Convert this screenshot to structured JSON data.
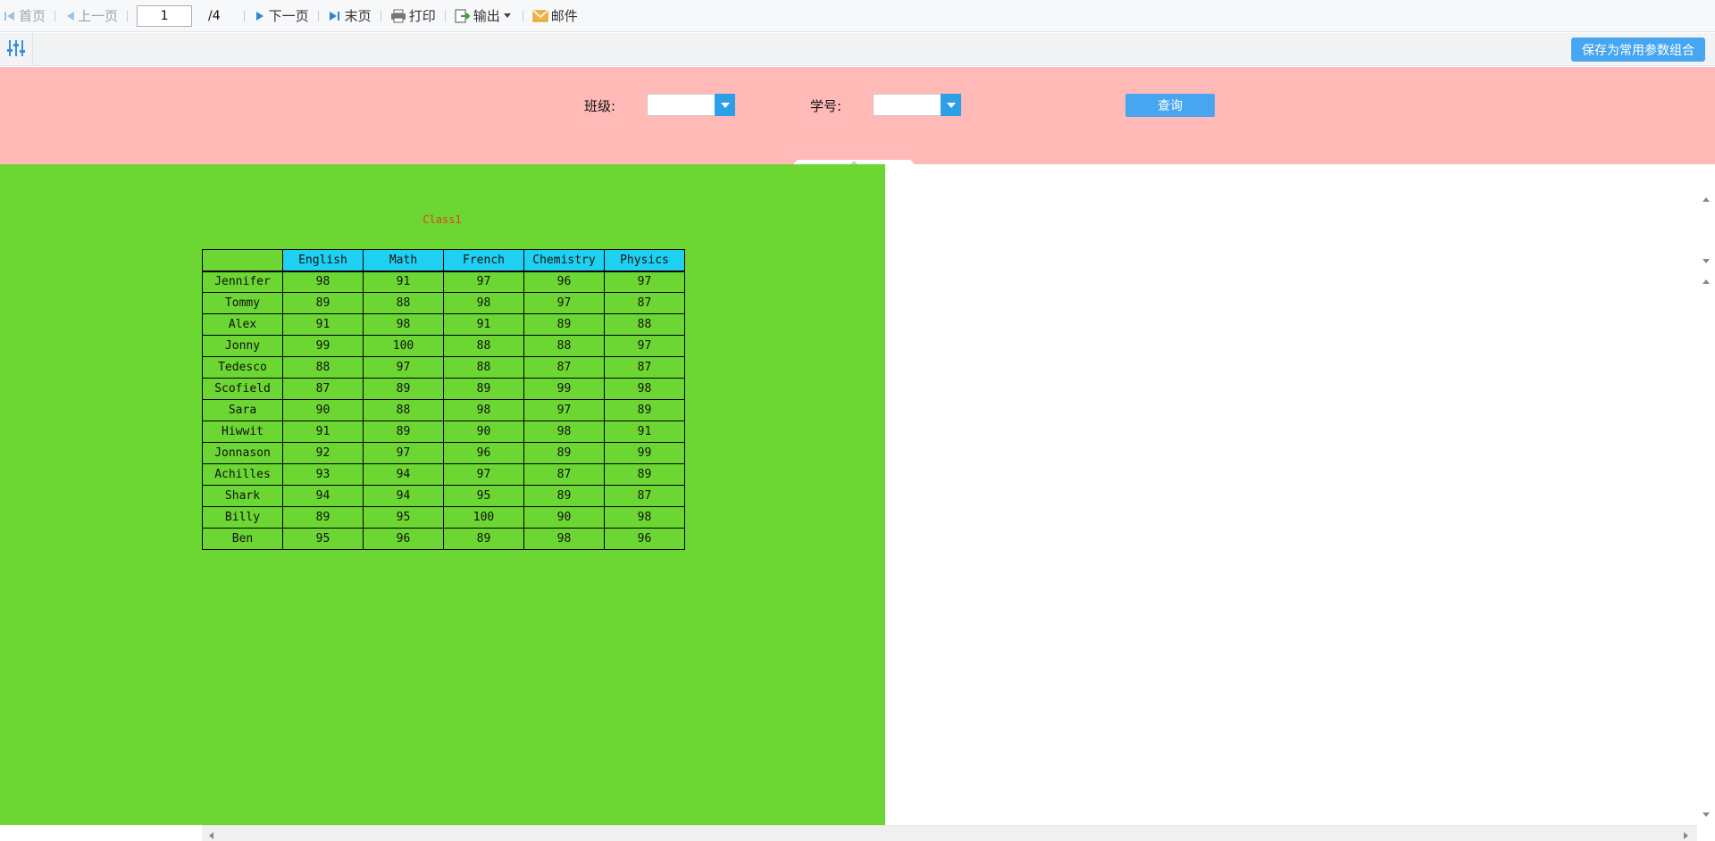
{
  "toolbar": {
    "first_label": "首页",
    "prev_label": "上一页",
    "page_current": "1",
    "page_total": "/4",
    "next_label": "下一页",
    "last_label": "末页",
    "print_label": "打印",
    "export_label": "输出",
    "mail_label": "邮件"
  },
  "params": {
    "save_combo_label": "保存为常用参数组合"
  },
  "query": {
    "class_label": "班级:",
    "student_id_label": "学号:",
    "submit_label": "查询"
  },
  "report": {
    "title": "Class1",
    "columns": [
      "",
      "English",
      "Math",
      "French",
      "Chemistry",
      "Physics"
    ],
    "rows": [
      [
        "Jennifer",
        "98",
        "91",
        "97",
        "96",
        "97"
      ],
      [
        "Tommy",
        "89",
        "88",
        "98",
        "97",
        "87"
      ],
      [
        "Alex",
        "91",
        "98",
        "91",
        "89",
        "88"
      ],
      [
        "Jonny",
        "99",
        "100",
        "88",
        "88",
        "97"
      ],
      [
        "Tedesco",
        "88",
        "97",
        "88",
        "87",
        "87"
      ],
      [
        "Scofield",
        "87",
        "89",
        "89",
        "99",
        "98"
      ],
      [
        "Sara",
        "90",
        "88",
        "98",
        "97",
        "89"
      ],
      [
        "Hiwwit",
        "91",
        "89",
        "90",
        "98",
        "91"
      ],
      [
        "Jonnason",
        "92",
        "97",
        "96",
        "89",
        "99"
      ],
      [
        "Achilles",
        "93",
        "94",
        "97",
        "87",
        "89"
      ],
      [
        "Shark",
        "94",
        "94",
        "95",
        "89",
        "87"
      ],
      [
        "Billy",
        "89",
        "95",
        "100",
        "90",
        "98"
      ],
      [
        "Ben",
        "95",
        "96",
        "89",
        "98",
        "96"
      ]
    ]
  },
  "colors": {
    "query_panel_bg": "#ffb9b6",
    "report_bg": "#6cd633",
    "header_cell_bg": "#1ed1f2",
    "title_color": "#e8401c",
    "accent_button": "#47a6ef"
  }
}
